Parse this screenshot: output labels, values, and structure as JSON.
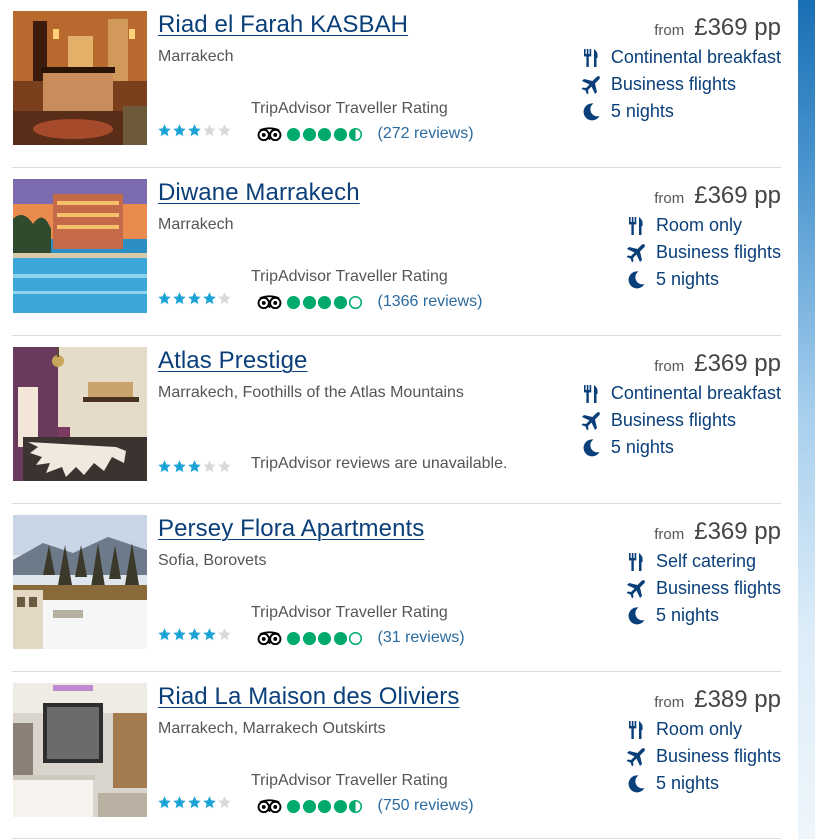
{
  "colors": {
    "link": "#0a3f7a",
    "star": "#1ba3d6",
    "star_empty": "#d9d9d9",
    "tripadvisor_green": "#00aa6c",
    "icon": "#0a3f7a"
  },
  "hotels": [
    {
      "name": "Riad el Farah KASBAH",
      "location": "Marrakech",
      "stars": 3,
      "ta_label": "TripAdvisor Traveller Rating",
      "ta_unavailable": "",
      "bubbles": 4.5,
      "reviews": "(272 reviews)",
      "from": "from",
      "price": "£369 pp",
      "board": "Continental breakfast",
      "flights": "Business flights",
      "nights": "5 nights",
      "board_icon": "cutlery-icon",
      "flight_icon": "plane-icon",
      "nights_icon": "moon-icon"
    },
    {
      "name": "Diwane Marrakech",
      "location": "Marrakech",
      "stars": 4,
      "ta_label": "TripAdvisor Traveller Rating",
      "ta_unavailable": "",
      "bubbles": 4,
      "reviews": "(1366 reviews)",
      "from": "from",
      "price": "£369 pp",
      "board": "Room only",
      "flights": "Business flights",
      "nights": "5 nights",
      "board_icon": "cutlery-icon",
      "flight_icon": "plane-icon",
      "nights_icon": "moon-icon"
    },
    {
      "name": "Atlas Prestige",
      "location": "Marrakech, Foothills of the Atlas Mountains",
      "stars": 3,
      "ta_label": "",
      "ta_unavailable": "TripAdvisor reviews are unavailable.",
      "bubbles": null,
      "reviews": "",
      "from": "from",
      "price": "£369 pp",
      "board": "Continental breakfast",
      "flights": "Business flights",
      "nights": "5 nights",
      "board_icon": "cutlery-icon",
      "flight_icon": "plane-icon",
      "nights_icon": "moon-icon"
    },
    {
      "name": "Persey Flora Apartments",
      "location": "Sofia, Borovets",
      "stars": 4,
      "ta_label": "TripAdvisor Traveller Rating",
      "ta_unavailable": "",
      "bubbles": 4,
      "reviews": "(31 reviews)",
      "from": "from",
      "price": "£369 pp",
      "board": "Self catering",
      "flights": "Business flights",
      "nights": "5 nights",
      "board_icon": "cutlery-icon",
      "flight_icon": "plane-icon",
      "nights_icon": "moon-icon"
    },
    {
      "name": "Riad La Maison des Oliviers",
      "location": "Marrakech, Marrakech Outskirts",
      "stars": 4,
      "ta_label": "TripAdvisor Traveller Rating",
      "ta_unavailable": "",
      "bubbles": 4.5,
      "reviews": "(750 reviews)",
      "from": "from",
      "price": "£389 pp",
      "board": "Room only",
      "flights": "Business flights",
      "nights": "5 nights",
      "board_icon": "cutlery-icon",
      "flight_icon": "plane-icon",
      "nights_icon": "moon-icon"
    }
  ]
}
